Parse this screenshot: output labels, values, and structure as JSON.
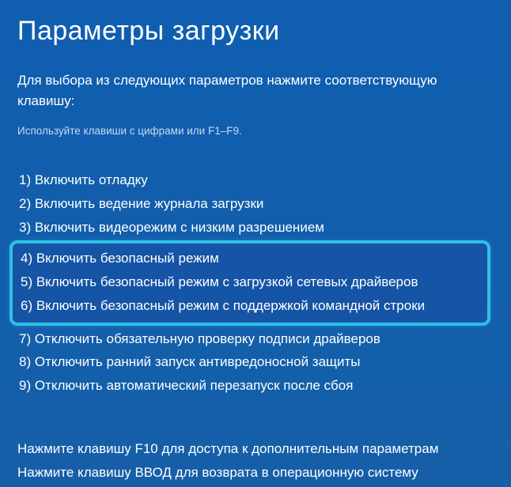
{
  "title": "Параметры загрузки",
  "subtitle": "Для выбора из следующих параметров нажмите соответствующую клавишу:",
  "hint": "Используйте клавиши с цифрами или F1–F9.",
  "options": {
    "item1": "1) Включить отладку",
    "item2": "2) Включить ведение журнала загрузки",
    "item3": "3) Включить видеорежим с низким разрешением",
    "item4": "4) Включить безопасный режим",
    "item5": "5) Включить безопасный режим с загрузкой сетевых драйверов",
    "item6": "6) Включить безопасный режим с поддержкой командной строки",
    "item7": "7) Отключить обязательную проверку подписи драйверов",
    "item8": "8) Отключить ранний запуск антивредоносной защиты",
    "item9": "9) Отключить автоматический перезапуск после сбоя"
  },
  "footer": {
    "line1": "Нажмите клавишу F10 для доступа к дополнительным параметрам",
    "line2": "Нажмите клавишу ВВОД для возврата в операционную систему"
  }
}
